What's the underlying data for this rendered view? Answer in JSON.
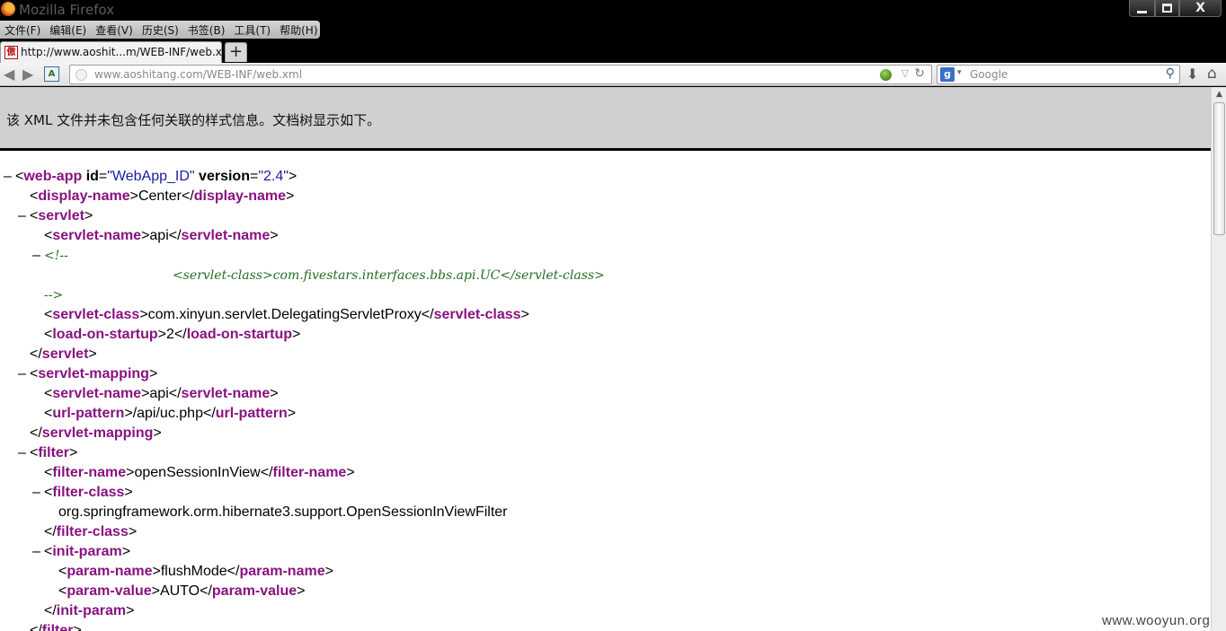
{
  "window": {
    "title": "Mozilla Firefox",
    "minimize_glyph": "",
    "close_glyph": "X"
  },
  "menu": [
    "文件(F)",
    "编辑(E)",
    "查看(V)",
    "历史(S)",
    "书签(B)",
    "工具(T)",
    "帮助(H)"
  ],
  "tab": {
    "title": "http://www.aoshit...m/WEB-INF/web.xml",
    "favicon_glyph": "傲",
    "new_tab_glyph": "+"
  },
  "nav": {
    "back_glyph": "◀",
    "forward_glyph": "▶",
    "site_icon_glyph": "A",
    "url": "www.aoshitang.com/WEB-INF/web.xml",
    "dropdown_glyph": "▽",
    "reload_glyph": "↻",
    "search_engine_glyph": "g",
    "search_engine_drop": "▾",
    "search_placeholder": "Google",
    "search_glyph": "⚲",
    "download_glyph": "⬇",
    "home_glyph": "⌂"
  },
  "info_message": "该 XML 文件并未包含任何关联的样式信息。文档树显示如下。",
  "collapse_glyph": "–",
  "xml_lines": [
    {
      "indent": 0,
      "tog": true,
      "parts": [
        [
          "p",
          "<"
        ],
        [
          "t",
          "web-app"
        ],
        [
          "p",
          " "
        ],
        [
          "a",
          "id"
        ],
        [
          "p",
          "="
        ],
        [
          "v",
          "\"WebApp_ID\""
        ],
        [
          "p",
          " "
        ],
        [
          "a",
          "version"
        ],
        [
          "p",
          "="
        ],
        [
          "v",
          "\"2.4\""
        ],
        [
          "p",
          ">"
        ]
      ]
    },
    {
      "indent": 1,
      "tog": false,
      "parts": [
        [
          "p",
          "<"
        ],
        [
          "t",
          "display-name"
        ],
        [
          "p",
          ">Center</"
        ],
        [
          "t",
          "display-name"
        ],
        [
          "p",
          ">"
        ]
      ]
    },
    {
      "indent": 1,
      "tog": true,
      "parts": [
        [
          "p",
          "<"
        ],
        [
          "t",
          "servlet"
        ],
        [
          "p",
          ">"
        ]
      ]
    },
    {
      "indent": 2,
      "tog": false,
      "parts": [
        [
          "p",
          "<"
        ],
        [
          "t",
          "servlet-name"
        ],
        [
          "p",
          ">api</"
        ],
        [
          "t",
          "servlet-name"
        ],
        [
          "p",
          ">"
        ]
      ]
    },
    {
      "indent": 2,
      "tog": true,
      "parts": [
        [
          "c",
          "<!--"
        ]
      ]
    },
    {
      "indent": 6,
      "tog": false,
      "parts": [
        [
          "c",
          "<servlet-class>com.fivestars.interfaces.bbs.api.UC</servlet-class>"
        ]
      ]
    },
    {
      "indent": 2,
      "tog": false,
      "parts": [
        [
          "c",
          "-->"
        ]
      ]
    },
    {
      "indent": 2,
      "tog": false,
      "parts": [
        [
          "p",
          "<"
        ],
        [
          "t",
          "servlet-class"
        ],
        [
          "p",
          ">com.xinyun.servlet.DelegatingServletProxy</"
        ],
        [
          "t",
          "servlet-class"
        ],
        [
          "p",
          ">"
        ]
      ]
    },
    {
      "indent": 2,
      "tog": false,
      "parts": [
        [
          "p",
          "<"
        ],
        [
          "t",
          "load-on-startup"
        ],
        [
          "p",
          ">2</"
        ],
        [
          "t",
          "load-on-startup"
        ],
        [
          "p",
          ">"
        ]
      ]
    },
    {
      "indent": 1,
      "tog": false,
      "parts": [
        [
          "p",
          "</"
        ],
        [
          "t",
          "servlet"
        ],
        [
          "p",
          ">"
        ]
      ]
    },
    {
      "indent": 1,
      "tog": true,
      "parts": [
        [
          "p",
          "<"
        ],
        [
          "t",
          "servlet-mapping"
        ],
        [
          "p",
          ">"
        ]
      ]
    },
    {
      "indent": 2,
      "tog": false,
      "parts": [
        [
          "p",
          "<"
        ],
        [
          "t",
          "servlet-name"
        ],
        [
          "p",
          ">api</"
        ],
        [
          "t",
          "servlet-name"
        ],
        [
          "p",
          ">"
        ]
      ]
    },
    {
      "indent": 2,
      "tog": false,
      "parts": [
        [
          "p",
          "<"
        ],
        [
          "t",
          "url-pattern"
        ],
        [
          "p",
          ">/api/uc.php</"
        ],
        [
          "t",
          "url-pattern"
        ],
        [
          "p",
          ">"
        ]
      ]
    },
    {
      "indent": 1,
      "tog": false,
      "parts": [
        [
          "p",
          "</"
        ],
        [
          "t",
          "servlet-mapping"
        ],
        [
          "p",
          ">"
        ]
      ]
    },
    {
      "indent": 1,
      "tog": true,
      "parts": [
        [
          "p",
          "<"
        ],
        [
          "t",
          "filter"
        ],
        [
          "p",
          ">"
        ]
      ]
    },
    {
      "indent": 2,
      "tog": false,
      "parts": [
        [
          "p",
          "<"
        ],
        [
          "t",
          "filter-name"
        ],
        [
          "p",
          ">openSessionInView</"
        ],
        [
          "t",
          "filter-name"
        ],
        [
          "p",
          ">"
        ]
      ]
    },
    {
      "indent": 2,
      "tog": true,
      "parts": [
        [
          "p",
          "<"
        ],
        [
          "t",
          "filter-class"
        ],
        [
          "p",
          ">"
        ]
      ]
    },
    {
      "indent": 3,
      "tog": false,
      "parts": [
        [
          "p",
          "org.springframework.orm.hibernate3.support.OpenSessionInViewFilter"
        ]
      ]
    },
    {
      "indent": 2,
      "tog": false,
      "parts": [
        [
          "p",
          "</"
        ],
        [
          "t",
          "filter-class"
        ],
        [
          "p",
          ">"
        ]
      ]
    },
    {
      "indent": 2,
      "tog": true,
      "parts": [
        [
          "p",
          "<"
        ],
        [
          "t",
          "init-param"
        ],
        [
          "p",
          ">"
        ]
      ]
    },
    {
      "indent": 3,
      "tog": false,
      "parts": [
        [
          "p",
          "<"
        ],
        [
          "t",
          "param-name"
        ],
        [
          "p",
          ">flushMode</"
        ],
        [
          "t",
          "param-name"
        ],
        [
          "p",
          ">"
        ]
      ]
    },
    {
      "indent": 3,
      "tog": false,
      "parts": [
        [
          "p",
          "<"
        ],
        [
          "t",
          "param-value"
        ],
        [
          "p",
          ">AUTO</"
        ],
        [
          "t",
          "param-value"
        ],
        [
          "p",
          ">"
        ]
      ]
    },
    {
      "indent": 2,
      "tog": false,
      "parts": [
        [
          "p",
          "</"
        ],
        [
          "t",
          "init-param"
        ],
        [
          "p",
          ">"
        ]
      ]
    },
    {
      "indent": 1,
      "tog": false,
      "parts": [
        [
          "p",
          "</"
        ],
        [
          "t",
          "filter"
        ],
        [
          "p",
          ">"
        ]
      ]
    }
  ],
  "scroll_up_glyph": "▲",
  "watermark": "www.wooyun.org"
}
